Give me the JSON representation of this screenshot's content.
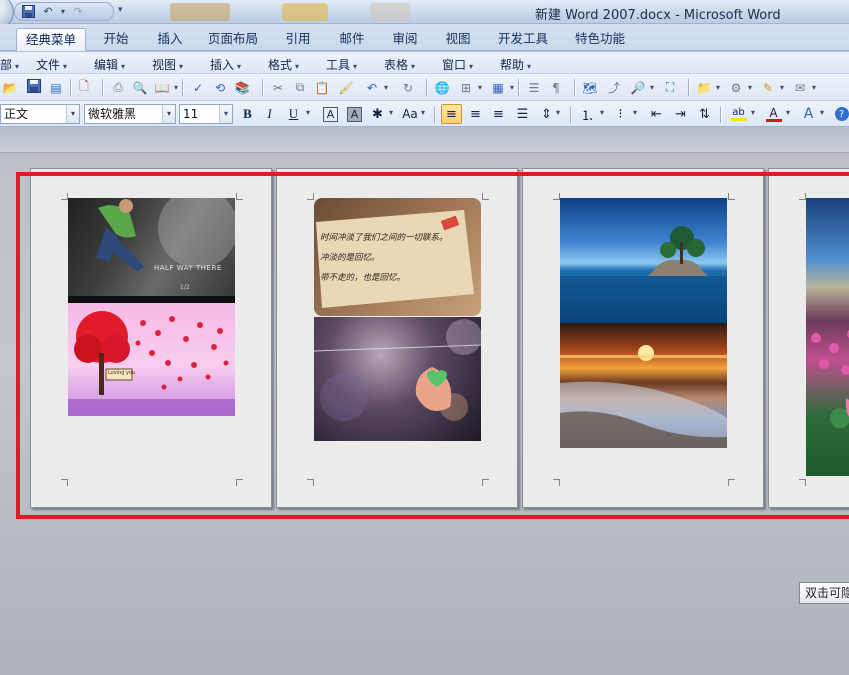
{
  "window": {
    "title": "新建 Word 2007.docx - Microsoft Word"
  },
  "quick_access": {
    "save_icon": "save-icon",
    "undo_icon": "undo-icon",
    "redo_icon": "redo-icon"
  },
  "tabs": [
    {
      "label": "经典菜单",
      "active": true
    },
    {
      "label": "开始"
    },
    {
      "label": "插入"
    },
    {
      "label": "页面布局"
    },
    {
      "label": "引用"
    },
    {
      "label": "邮件"
    },
    {
      "label": "审阅"
    },
    {
      "label": "视图"
    },
    {
      "label": "开发工具"
    },
    {
      "label": "特色功能"
    }
  ],
  "menus": [
    {
      "label": "部"
    },
    {
      "label": "文件"
    },
    {
      "label": "编辑"
    },
    {
      "label": "视图"
    },
    {
      "label": "插入"
    },
    {
      "label": "格式"
    },
    {
      "label": "工具"
    },
    {
      "label": "表格"
    },
    {
      "label": "窗口"
    },
    {
      "label": "帮助"
    }
  ],
  "format": {
    "style": "正文",
    "font": "微软雅黑",
    "size": "11",
    "bold": "B",
    "italic": "I",
    "underline": "U",
    "char_border": "A",
    "char_shading": "A",
    "change_case": "Aa",
    "highlight_label": "ab",
    "font_color_label": "A",
    "text_effects_label": "A"
  },
  "pages": [
    {
      "images": [
        "running-man-photo",
        "red-heart-tree-illustration"
      ],
      "texts": {
        "poster": "HALF WAY THERE",
        "poster_small": "1/2",
        "sign": "Loving you"
      }
    },
    {
      "images": [
        "handwritten-note-photo",
        "heart-leaf-bokeh-photo"
      ],
      "texts": {
        "note": "时间冲淡了我们之间的一切联系。\n冲淡的是回忆。\n带不走的，也是回忆。"
      }
    },
    {
      "images": [
        "island-seascape-photo",
        "sunset-beach-photo"
      ]
    },
    {
      "images": [
        "flower-field-photo"
      ]
    }
  ],
  "tooltip": {
    "text": "双击可隐"
  },
  "colors": {
    "selection_frame": "#df1b24",
    "highlight_bar": "#f5e41a",
    "font_color_bar": "#d8141c"
  }
}
